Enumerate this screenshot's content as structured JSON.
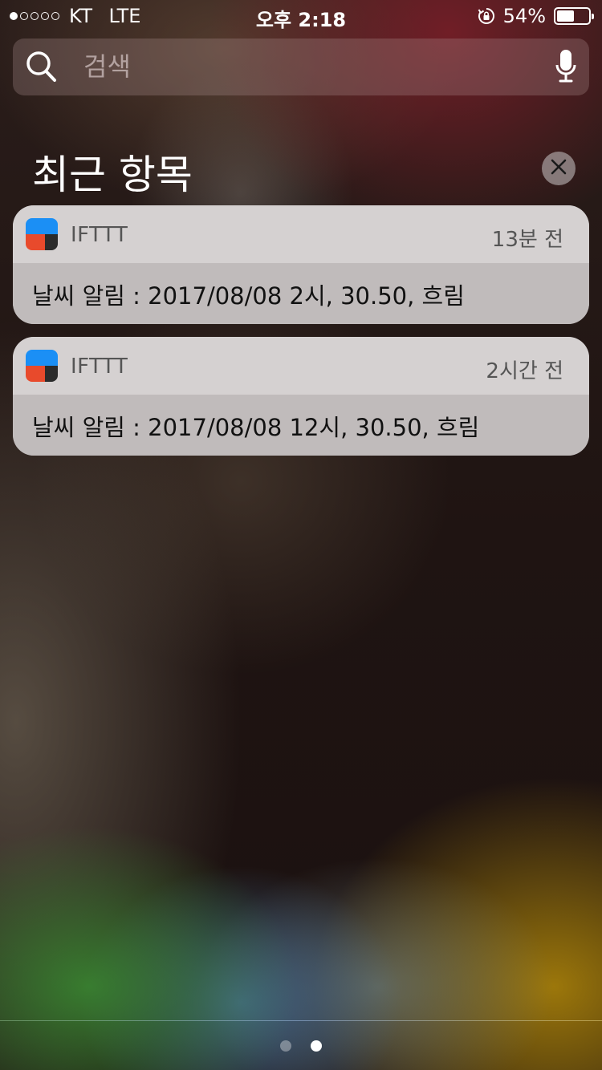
{
  "status_bar": {
    "signal_strength": 1,
    "signal_max": 5,
    "carrier": "KT",
    "network": "LTE",
    "time": "오후 2:18",
    "battery_percent": "54%",
    "battery_level": 0.54
  },
  "search": {
    "placeholder": "검색",
    "value": ""
  },
  "recents": {
    "title": "최근 항목",
    "clear_icon": "close-icon",
    "notifications": [
      {
        "app_name": "IFTTT",
        "time": "13분 전",
        "message": "날씨 알림 : 2017/08/08 2시, 30.50, 흐림"
      },
      {
        "app_name": "IFTTT",
        "time": "2시간 전",
        "message": "날씨 알림 : 2017/08/08 12시, 30.50, 흐림"
      }
    ]
  },
  "page_indicator": {
    "total": 2,
    "current": 2
  },
  "colors": {
    "ifttt_blue": "#1b8ff5",
    "ifttt_red": "#e84a2c",
    "ifttt_dark": "#2b2b2b"
  }
}
